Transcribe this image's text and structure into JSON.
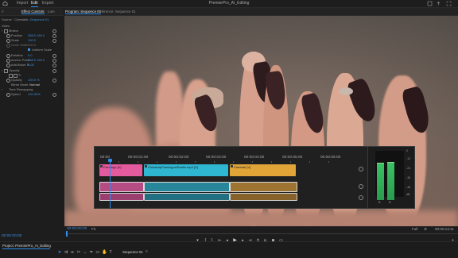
{
  "app": {
    "title": "PremierPro_AI_Editing",
    "workspace_tabs": [
      "Import",
      "Edit",
      "Export"
    ],
    "active_tab": "Edit"
  },
  "left_panel": {
    "tabs": [
      "Effect Controls",
      "Lum"
    ],
    "source_label": "Source · Cheetahtr...",
    "sequence_label": "Sequence 01",
    "video_header": "Video",
    "rows": [
      {
        "label": "Motion"
      },
      {
        "label": "Position",
        "value": "288.0   180.0"
      },
      {
        "label": "Scale",
        "value": "100.0"
      },
      {
        "label": "Scale Width",
        "value": "100.0"
      },
      {
        "label": "Uniform Scale"
      },
      {
        "label": "Rotation",
        "value": "0.0"
      },
      {
        "label": "Anchor Point",
        "value": "288.0   180.0"
      },
      {
        "label": "Anti-flicker Fi...",
        "value": "0.00"
      },
      {
        "label": "Opacity"
      },
      {
        "label": "Opacity",
        "value": "100.0 %"
      },
      {
        "label": "Blend Mode",
        "value": "Normal"
      },
      {
        "label": "Time Remapping"
      },
      {
        "label": "Speed",
        "value": "100.00%"
      }
    ],
    "timecode": "00:00:00:00"
  },
  "program_monitor": {
    "tabs": [
      "Program: Sequence 01",
      "Reference: Sequence 01"
    ],
    "timecode": "00:00:00:00",
    "fit": "Fit",
    "resolution": "Full",
    "duration": "00:00:14:11"
  },
  "timeline": {
    "timecodes": [
      "00:00",
      "00:00:01:00",
      "00:00:02:00",
      "00:00:03:00",
      "00:00:04:00",
      "00:00:05:00",
      "00:00:06:00"
    ],
    "clips": [
      {
        "label": "Flamingo [V]",
        "color": "#e45a9e"
      },
      {
        "label": "ChinstrapFlamingosSharks.mp4 [V]",
        "color": "#2fb6d1"
      },
      {
        "label": "Cheetah [V]",
        "color": "#e0a437"
      }
    ]
  },
  "meter": {
    "scale": [
      "0",
      "-12",
      "-24",
      "-36",
      "-48",
      "dB"
    ],
    "left_level_db": -5,
    "right_level_db": -4,
    "channels": [
      "S",
      "S"
    ]
  },
  "bottom": {
    "project_tab": "Project: PremierPro_AI_Editing",
    "sequence_tab": "Sequence 01"
  },
  "colors": {
    "accent": "#2d8ceb",
    "value_blue": "#3d8fe0"
  }
}
